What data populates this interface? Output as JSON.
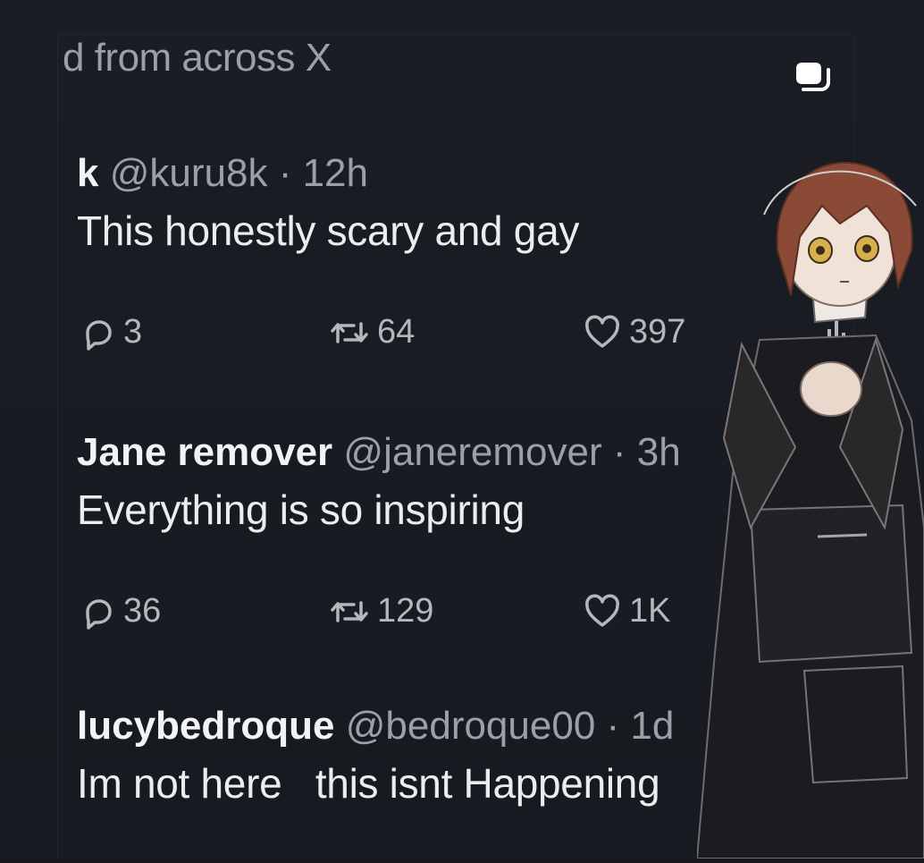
{
  "header": {
    "text": "d from across X"
  },
  "tweets": [
    {
      "name": "k",
      "handle": "@kuru8k",
      "separator": "·",
      "time": "12h",
      "text": "This honestly scary and gay",
      "replies": "3",
      "reposts": "64",
      "likes": "397"
    },
    {
      "name": "Jane remover",
      "handle": "@janeremover",
      "separator": "·",
      "time": "3h",
      "text": "Everything is so inspiring",
      "replies": "36",
      "reposts": "129",
      "likes": "1K"
    },
    {
      "name": "lucybedroque",
      "handle": "@bedroque00",
      "separator": "·",
      "time": "1d",
      "text": "Im not here   this isnt Happening"
    }
  ],
  "icons": {
    "reply": "reply-icon",
    "repost": "repost-icon",
    "like": "heart-icon",
    "views": "views-icon",
    "share": "share-icon"
  },
  "colors": {
    "background": "#16181d",
    "text": "#e7e9ea",
    "muted": "#9aa0a6"
  }
}
